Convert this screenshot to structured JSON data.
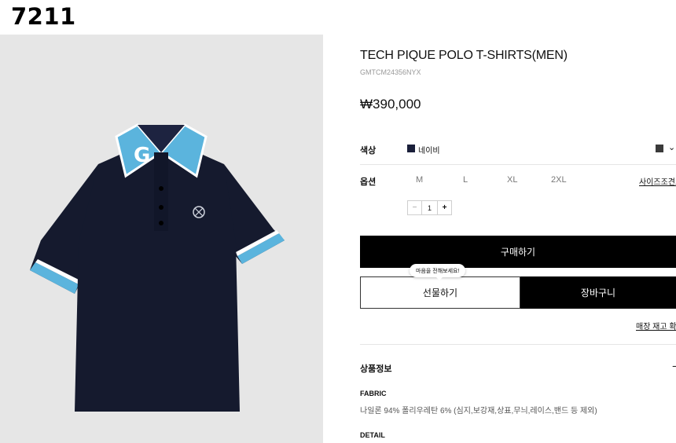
{
  "overlay_label": "7211",
  "product": {
    "title": "TECH PIQUE POLO T-SHIRTS(MEN)",
    "sku": "GMTCM24356NYX",
    "price": "₩390,000",
    "image_icon": "navy-polo-shirt-image"
  },
  "color_option": {
    "label": "색상",
    "selected_name": "네이비",
    "swatch_color": "#1a1f3a",
    "dropdown_swatch_color": "#3a3a3a",
    "dropdown_icon": "chevron-down-icon"
  },
  "size_option": {
    "label": "옵션",
    "sizes": [
      "M",
      "L",
      "XL",
      "2XL"
    ],
    "size_guide_label": "사이즈조견표"
  },
  "quantity": {
    "minus": "−",
    "value": "1",
    "plus": "+"
  },
  "actions": {
    "buy_label": "구매하기",
    "gift_label": "선물하기",
    "gift_tooltip": "마음을 전해보세요!",
    "cart_label": "장바구니",
    "store_stock_label": "매장 재고 확인"
  },
  "product_info": {
    "section_label": "상품정보",
    "collapse_symbol": "−",
    "fabric_label": "FABRIC",
    "fabric_text": "나일론 94% 폴리우레탄 6% (심지,보강재,상표,무늬,레이스,밴드 등 제외)",
    "detail_label": "DETAIL"
  },
  "colors": {
    "shirt_navy": "#151a2e",
    "collar_blue": "#5bb4dd",
    "button_black": "#000000"
  }
}
